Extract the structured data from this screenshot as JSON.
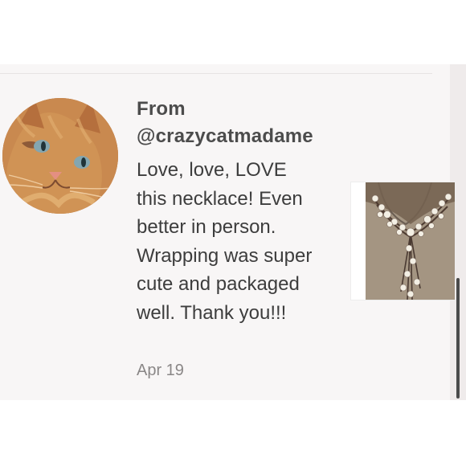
{
  "review": {
    "from_label": "From",
    "username": "@crazycatmadame",
    "text": "Love, love, LOVE this necklace! Even better in person. Wrapping was super cute and packaged well. Thank you!!!",
    "date": "Apr 19"
  },
  "icons": {
    "avatar": "orange-cat-photo",
    "product": "pearl-necklace-photo"
  },
  "colors": {
    "card_background": "#f8f6f6",
    "text": "#3d3d3d",
    "muted_text": "#8a8787",
    "scrollbar": "#4b4b4b"
  }
}
